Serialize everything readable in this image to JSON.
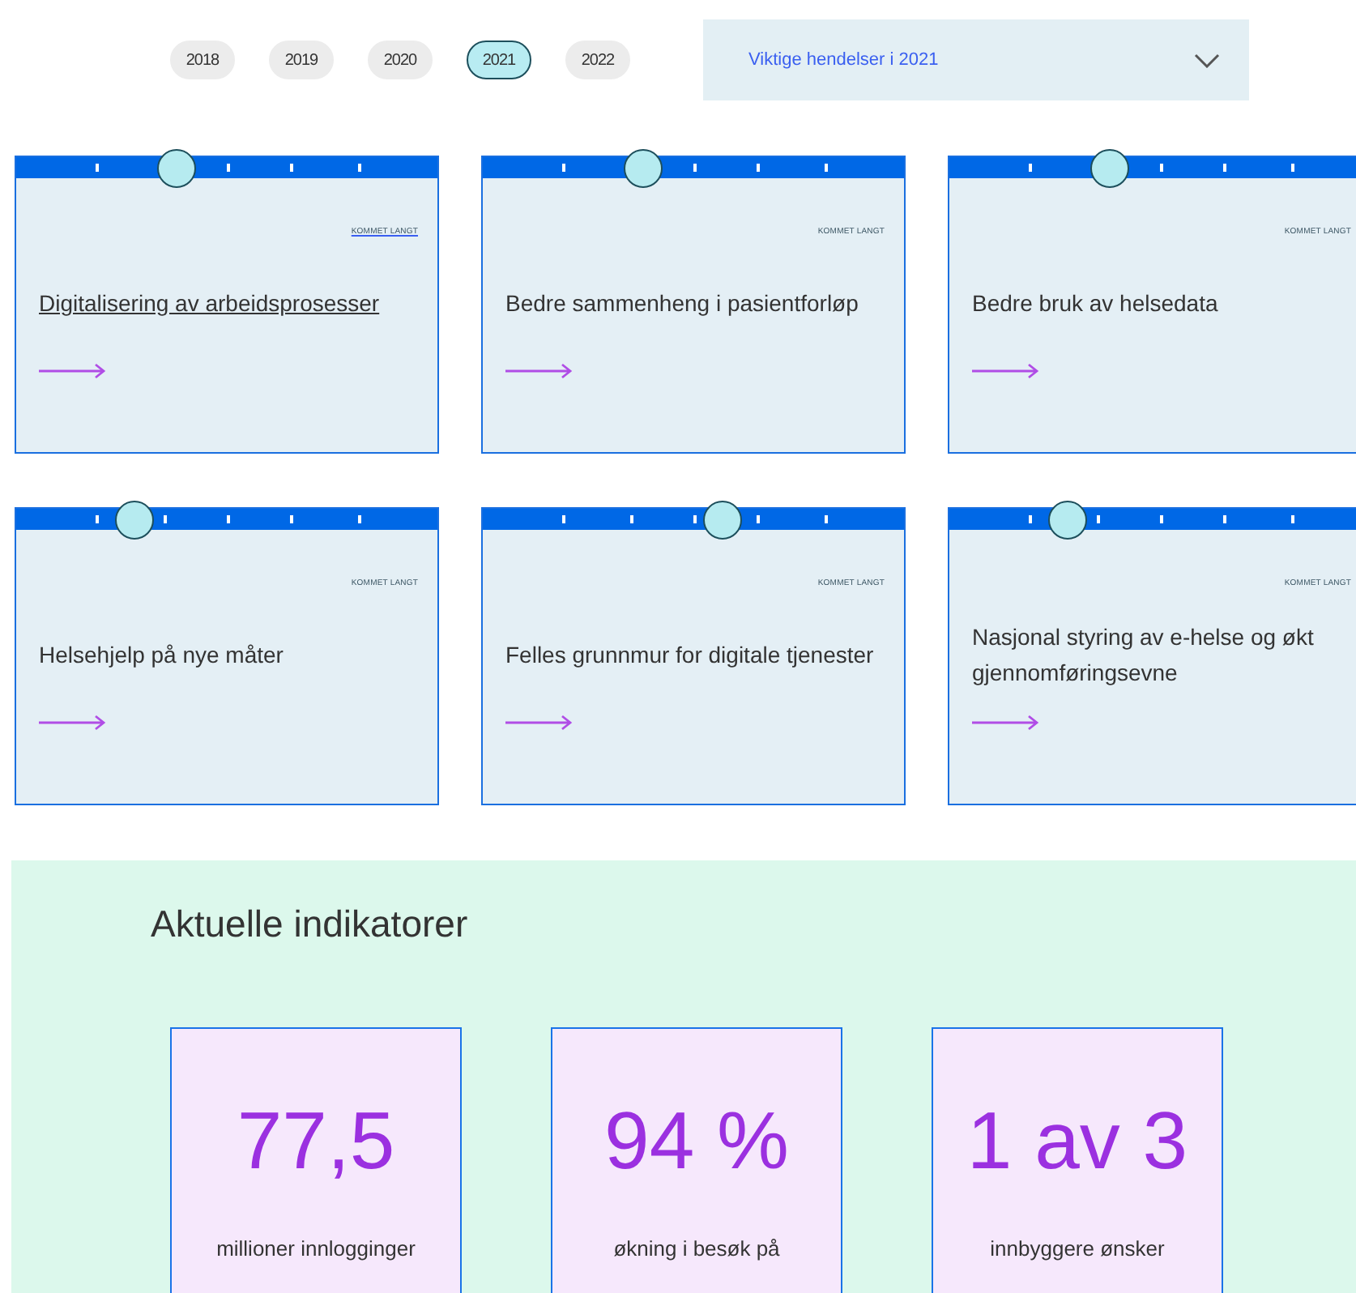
{
  "years": [
    {
      "label": "2018",
      "selected": false
    },
    {
      "label": "2019",
      "selected": false
    },
    {
      "label": "2020",
      "selected": false
    },
    {
      "label": "2021",
      "selected": true
    },
    {
      "label": "2022",
      "selected": false
    }
  ],
  "dropdown": {
    "value": "Viktige hendelser i 2021"
  },
  "cards": [
    {
      "status": "KOMMET LANGT",
      "title": "Digitalisering av arbeidsprosesser",
      "level": 0.38,
      "focused": true
    },
    {
      "status": "KOMMET LANGT",
      "title": "Bedre sammenheng i pasientforløp",
      "level": 0.38,
      "focused": false
    },
    {
      "status": "KOMMET LANGT",
      "title": "Bedre bruk av helsedata",
      "level": 0.38,
      "focused": false
    },
    {
      "status": "KOMMET LANGT",
      "title": "Helsehjelp på nye måter",
      "level": 0.28,
      "focused": false
    },
    {
      "status": "KOMMET LANGT",
      "title": "Felles grunnmur for digitale tjenester",
      "level": 0.57,
      "focused": false
    },
    {
      "status": "KOMMET LANGT",
      "title": "Nasjonal styring av e-helse og økt gjennomføringsevne",
      "level": 0.28,
      "focused": false
    }
  ],
  "indicators": {
    "heading": "Aktuelle indikatorer",
    "items": [
      {
        "value": "77,5",
        "label": "millioner innlogginger"
      },
      {
        "value": "94 %",
        "label": "økning i besøk på"
      },
      {
        "value": "1 av 3",
        "label": "innbyggere ønsker"
      }
    ]
  }
}
